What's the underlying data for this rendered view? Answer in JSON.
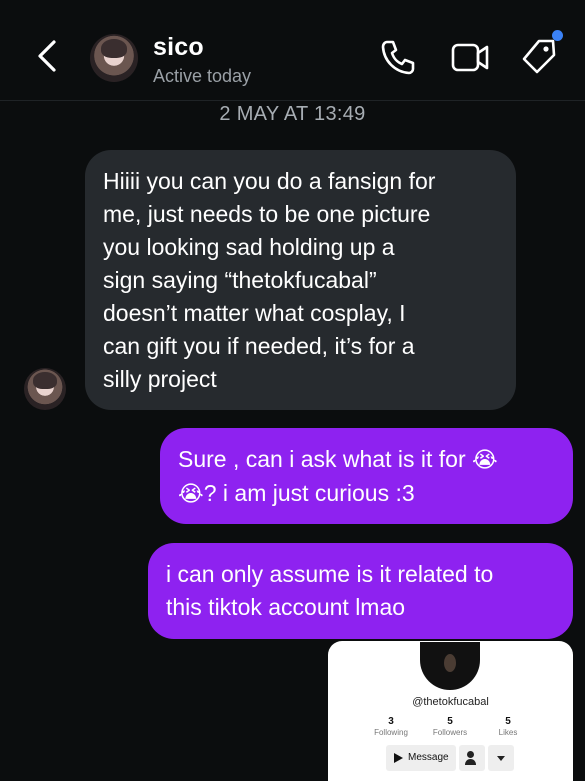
{
  "header": {
    "name": "sico",
    "status": "Active today",
    "icons": [
      "back-icon",
      "phone-icon",
      "video-camera-icon",
      "tag-icon"
    ],
    "accent": "#3b82f6"
  },
  "thread": {
    "date": "2 MAY AT 13:49",
    "incoming_color": "#262a2e",
    "outgoing_color": "#8e22f0",
    "messages": [
      {
        "direction": "incoming",
        "text": "Hiiii you can you do a fansign for\nme, just needs to be one picture\nyou looking sad  holding up a\nsign saying “thetokfucabal”\ndoesn’t matter what cosplay, I\ncan gift you if needed, it’s for a\nsilly project"
      },
      {
        "direction": "outgoing",
        "line1": "Sure , can i ask what is it for ",
        "emoji1": "😭",
        "emoji2": "😭",
        "line2": "? i am just curious :3"
      },
      {
        "direction": "outgoing",
        "text": "i can only assume is it related to\nthis tiktok account lmao"
      }
    ]
  },
  "preview": {
    "handle": "@thetokfucabal",
    "following_count": "3",
    "following_label": "Following",
    "followers_count": "5",
    "followers_label": "Followers",
    "likes_count": "5",
    "likes_label": "Likes",
    "message_label": "Message"
  }
}
